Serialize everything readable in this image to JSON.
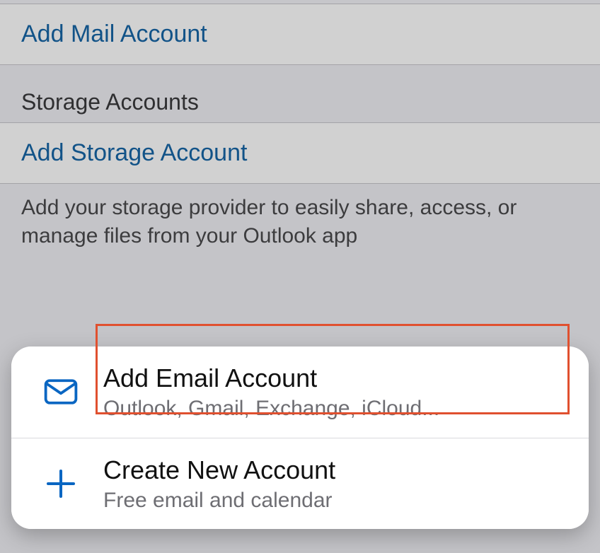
{
  "colors": {
    "link": "#1766a6",
    "highlight": "#e0502f"
  },
  "bg": {
    "addMailLabel": "Add Mail Account",
    "storageHeader": "Storage Accounts",
    "addStorageLabel": "Add Storage Account",
    "footnote": "Add your storage provider to easily share, access, or manage files from your Outlook app"
  },
  "sheet": {
    "items": [
      {
        "icon": "mail-icon",
        "title": "Add Email Account",
        "subtitle": "Outlook, Gmail, Exchange, iCloud..."
      },
      {
        "icon": "plus-icon",
        "title": "Create New Account",
        "subtitle": "Free email and calendar"
      }
    ]
  }
}
